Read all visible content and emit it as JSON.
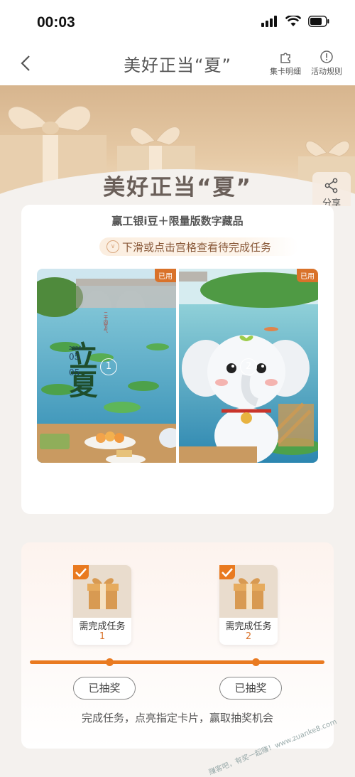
{
  "status": {
    "time": "00:03"
  },
  "nav": {
    "title": "美好正当“夏”",
    "detail_label": "集卡明细",
    "rules_label": "活动规则"
  },
  "hero": {
    "title": "美好正当“夏”",
    "share_label": "分享"
  },
  "card": {
    "subtitle": "赢工银i豆＋限量版数字藏品",
    "hint": "下滑或点击宫格查看待完成任务",
    "panels": [
      {
        "num": "1",
        "tag": "已用",
        "art_big": "立夏",
        "art_small": "二十四节气",
        "art_month": "05",
        "art_day": "05",
        "art_year": "2026"
      },
      {
        "num": "2",
        "tag": "已用"
      }
    ]
  },
  "tasks": {
    "items": [
      {
        "label": "需完成任务",
        "num": "1",
        "button": "已抽奖"
      },
      {
        "label": "需完成任务",
        "num": "2",
        "button": "已抽奖"
      }
    ],
    "footer": "完成任务，点亮指定卡片，赢取抽奖机会"
  },
  "watermark": "赚客吧，有奖一起赚！www.zuanke8.com",
  "colors": {
    "accent": "#e97a20",
    "tag": "#d9722a",
    "hero": "#d7b58e"
  }
}
